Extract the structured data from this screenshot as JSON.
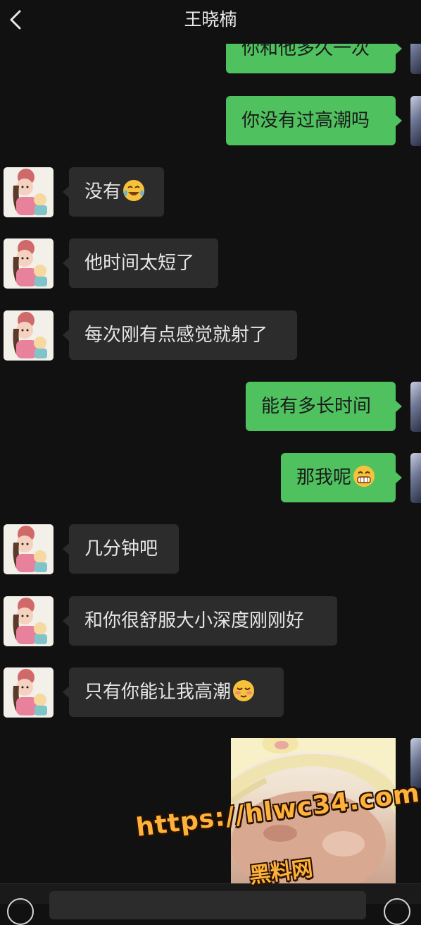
{
  "header": {
    "title": "王晓楠",
    "back_icon": "chevron-left-icon"
  },
  "messages": [
    {
      "side": "out",
      "text": "你和他多久一次"
    },
    {
      "side": "out",
      "text": "你没有过高潮吗"
    },
    {
      "side": "in",
      "text": "没有",
      "emoji": "crying-laughing-emoji"
    },
    {
      "side": "in",
      "text": "他时间太短了"
    },
    {
      "side": "in",
      "text": "每次刚有点感觉就射了"
    },
    {
      "side": "out",
      "text": "能有多长时间"
    },
    {
      "side": "out",
      "text": "那我呢",
      "emoji": "grinning-emoji"
    },
    {
      "side": "in",
      "text": "几分钟吧"
    },
    {
      "side": "in",
      "text": "和你很舒服大小深度刚刚好"
    },
    {
      "side": "in",
      "text": "只有你能让我高潮",
      "emoji": "blushing-emoji"
    },
    {
      "side": "out",
      "type": "image",
      "icon": "photo-message"
    }
  ],
  "watermark": {
    "line1": "https://hlwc34.com",
    "line2": "黑料网"
  },
  "colors": {
    "background": "#111111",
    "incoming_bubble": "#2c2c2c",
    "outgoing_bubble": "#4fc15f",
    "watermark": "#ffb23b"
  },
  "input_bar": {
    "voice_icon": "voice-icon",
    "emoji_icon": "emoji-icon"
  }
}
